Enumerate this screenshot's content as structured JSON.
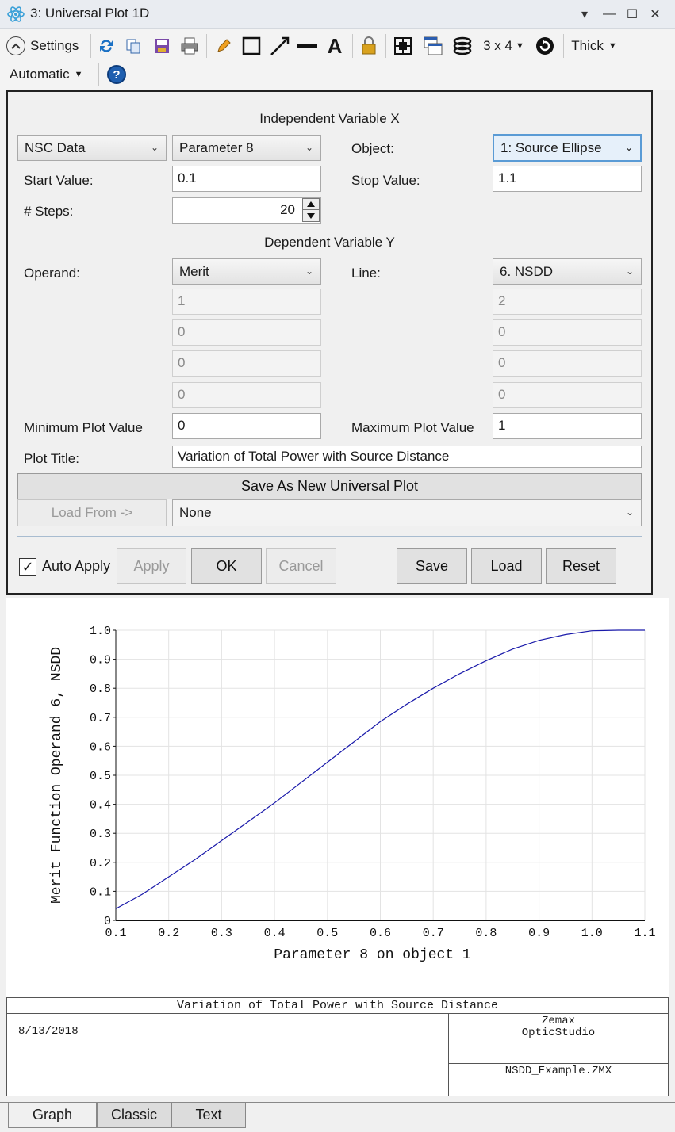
{
  "window": {
    "title": "3: Universal Plot 1D",
    "controls": {
      "dropdown": "▾",
      "minimize": "—",
      "maximize": "☐",
      "close": "✕"
    }
  },
  "toolbar": {
    "settings_label": "Settings",
    "layout_label": "3 x 4",
    "line_label": "Thick",
    "scale_label": "Automatic",
    "help_label": "?",
    "text_tool": "A"
  },
  "panel": {
    "indep_header": "Independent Variable X",
    "dep_header": "Dependent Variable Y",
    "data_type": "NSC Data",
    "parameter": "Parameter 8",
    "object_label": "Object:",
    "object_value": "1: Source Ellipse",
    "start_label": "Start Value:",
    "start_value": "0.1",
    "stop_label": "Stop Value:",
    "stop_value": "1.1",
    "steps_label": "# Steps:",
    "steps_value": "20",
    "operand_label": "Operand:",
    "operand_value": "Merit",
    "line_label": "Line:",
    "line_value": "6. NSDD",
    "left_params": [
      "1",
      "0",
      "0",
      "0"
    ],
    "right_params": [
      "2",
      "0",
      "0",
      "0"
    ],
    "min_label": "Minimum Plot Value",
    "min_value": "0",
    "max_label": "Maximum Plot Value",
    "max_value": "1",
    "title_label": "Plot Title:",
    "title_value": "Variation of Total Power with Source Distance",
    "save_new_label": "Save As New Universal Plot",
    "load_from_label": "Load From ->",
    "load_from_value": "None",
    "auto_apply_label": "Auto Apply",
    "auto_apply_checked": "✓",
    "apply_label": "Apply",
    "ok_label": "OK",
    "cancel_label": "Cancel",
    "save_label": "Save",
    "load_label": "Load",
    "reset_label": "Reset"
  },
  "chart_data": {
    "type": "line",
    "xlabel": "Parameter 8 on object 1",
    "ylabel": "Merit Function Operand 6, NSDD",
    "xlim": [
      0.1,
      1.1
    ],
    "ylim": [
      0,
      1.0
    ],
    "xticks": [
      "0.1",
      "0.2",
      "0.3",
      "0.4",
      "0.5",
      "0.6",
      "0.7",
      "0.8",
      "0.9",
      "1.0",
      "1.1"
    ],
    "yticks": [
      "0",
      "0.1",
      "0.2",
      "0.3",
      "0.4",
      "0.5",
      "0.6",
      "0.7",
      "0.8",
      "0.9",
      "1.0"
    ],
    "grid": true,
    "line_color": "#1a1aaa",
    "series": [
      {
        "x": [
          0.1,
          0.15,
          0.2,
          0.25,
          0.3,
          0.35,
          0.4,
          0.45,
          0.5,
          0.55,
          0.6,
          0.65,
          0.7,
          0.75,
          0.8,
          0.85,
          0.9,
          0.95,
          1.0,
          1.05,
          1.1
        ],
        "values": [
          0.04,
          0.09,
          0.15,
          0.21,
          0.275,
          0.34,
          0.405,
          0.475,
          0.545,
          0.615,
          0.685,
          0.745,
          0.8,
          0.85,
          0.895,
          0.935,
          0.965,
          0.985,
          0.998,
          1.0,
          1.0
        ]
      }
    ]
  },
  "footer": {
    "title": "Variation of Total Power with Source Distance",
    "date": "8/13/2018",
    "brand_line1": "Zemax",
    "brand_line2": "OpticStudio",
    "filename": "NSDD_Example.ZMX"
  },
  "tabs": [
    "Graph",
    "Classic",
    "Text"
  ]
}
